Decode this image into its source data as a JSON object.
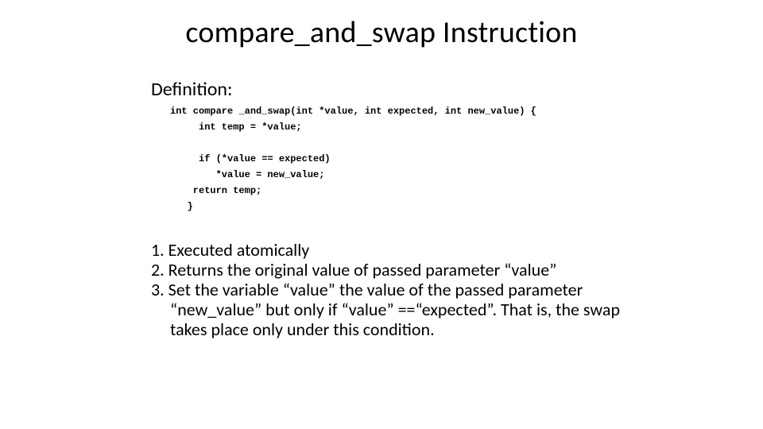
{
  "title": "compare_and_swap Instruction",
  "definition_label": "Definition:",
  "code": {
    "l1": "int compare _and_swap(int *value, int expected, int new_value) {",
    "l2": "     int temp = *value;",
    "l3": "",
    "l4": "     if (*value == expected)",
    "l5": "        *value = new_value;",
    "l6": "    return temp;",
    "l7": "   }"
  },
  "bullets": {
    "b1": "1. Executed atomically",
    "b2": "2. Returns the original value of passed parameter “value”",
    "b3": "3. Set  the variable “value”  the value of the passed parameter “new_value” but only if “value” ==“expected”. That is, the swap takes place only under this condition."
  }
}
